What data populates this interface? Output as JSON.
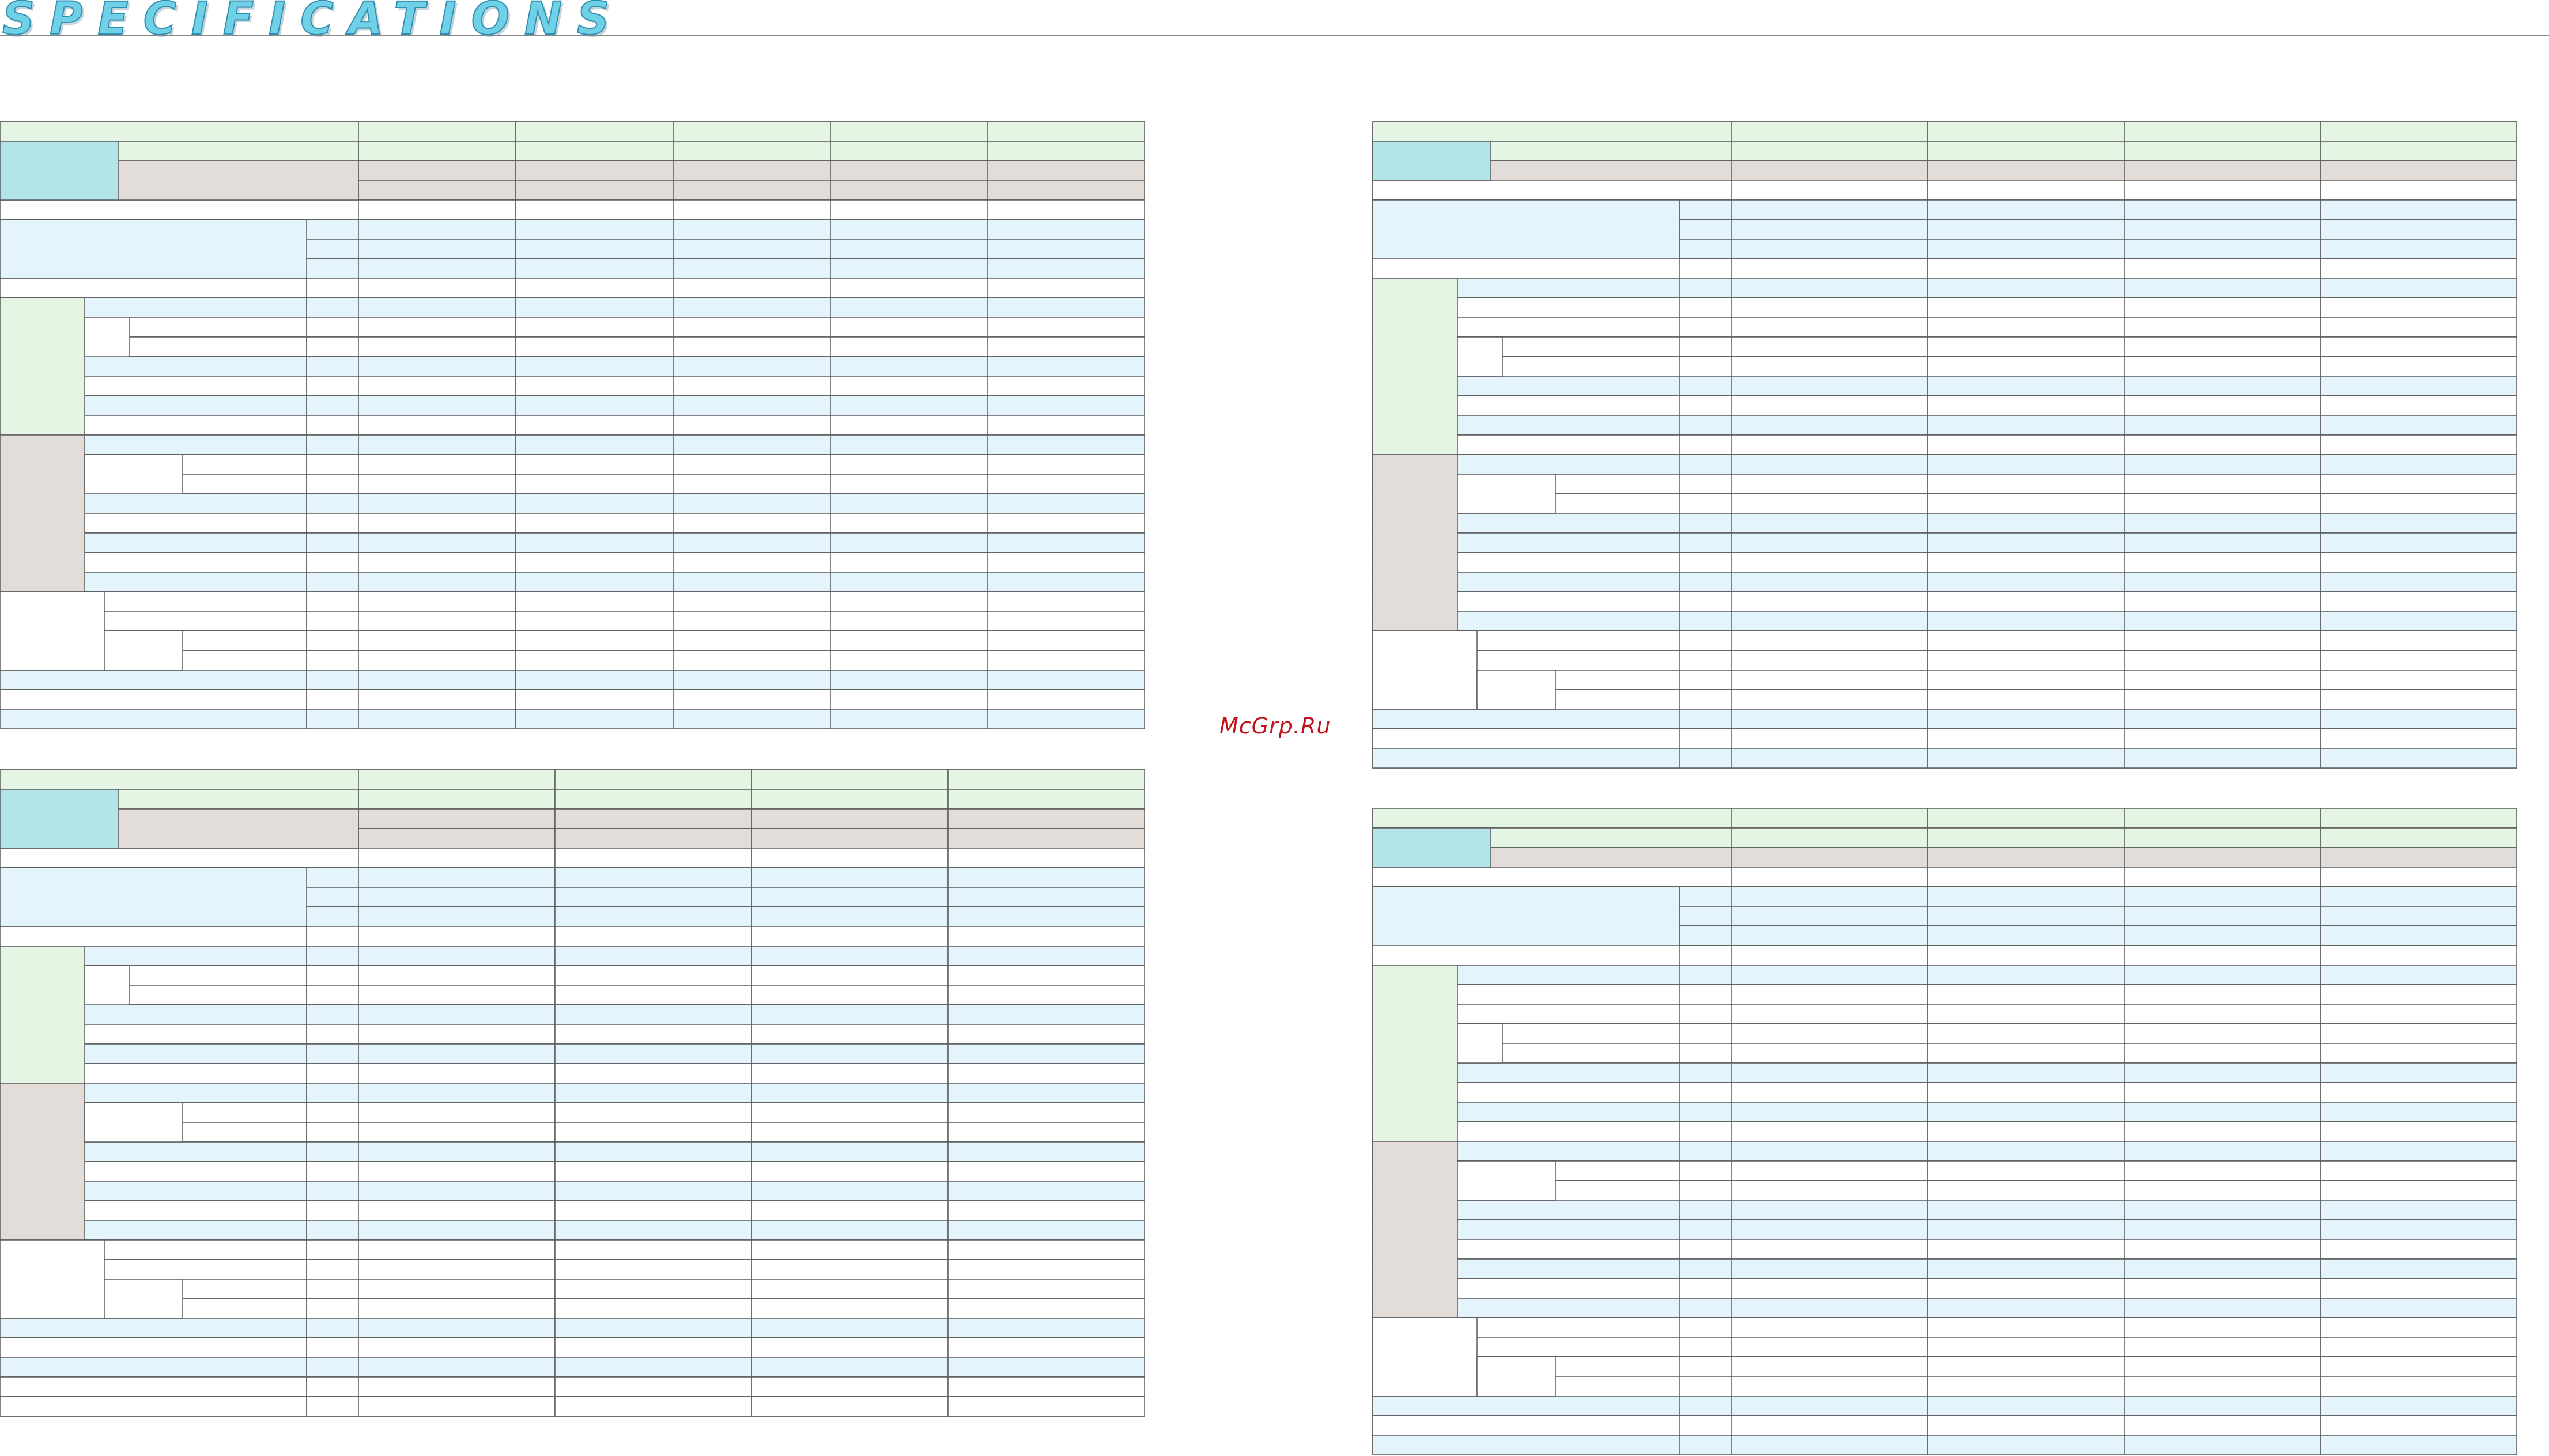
{
  "header": {
    "title": "SPECIFICATIONS"
  },
  "watermark": {
    "text": "McGrp.Ru"
  },
  "colors": {
    "header_green": "#e4f5e4",
    "model_teal": "#b3e5e8",
    "model_beige": "#e2ddd9",
    "row_blue": "#e3f4fc",
    "title_cyan": "#6fd0e6",
    "watermark_red": "#c0141c"
  },
  "tables": [
    {
      "id": "top-left",
      "label": ""
    },
    {
      "id": "bottom-left",
      "label": ""
    },
    {
      "id": "top-right",
      "label": ""
    },
    {
      "id": "bottom-right",
      "label": ""
    }
  ]
}
